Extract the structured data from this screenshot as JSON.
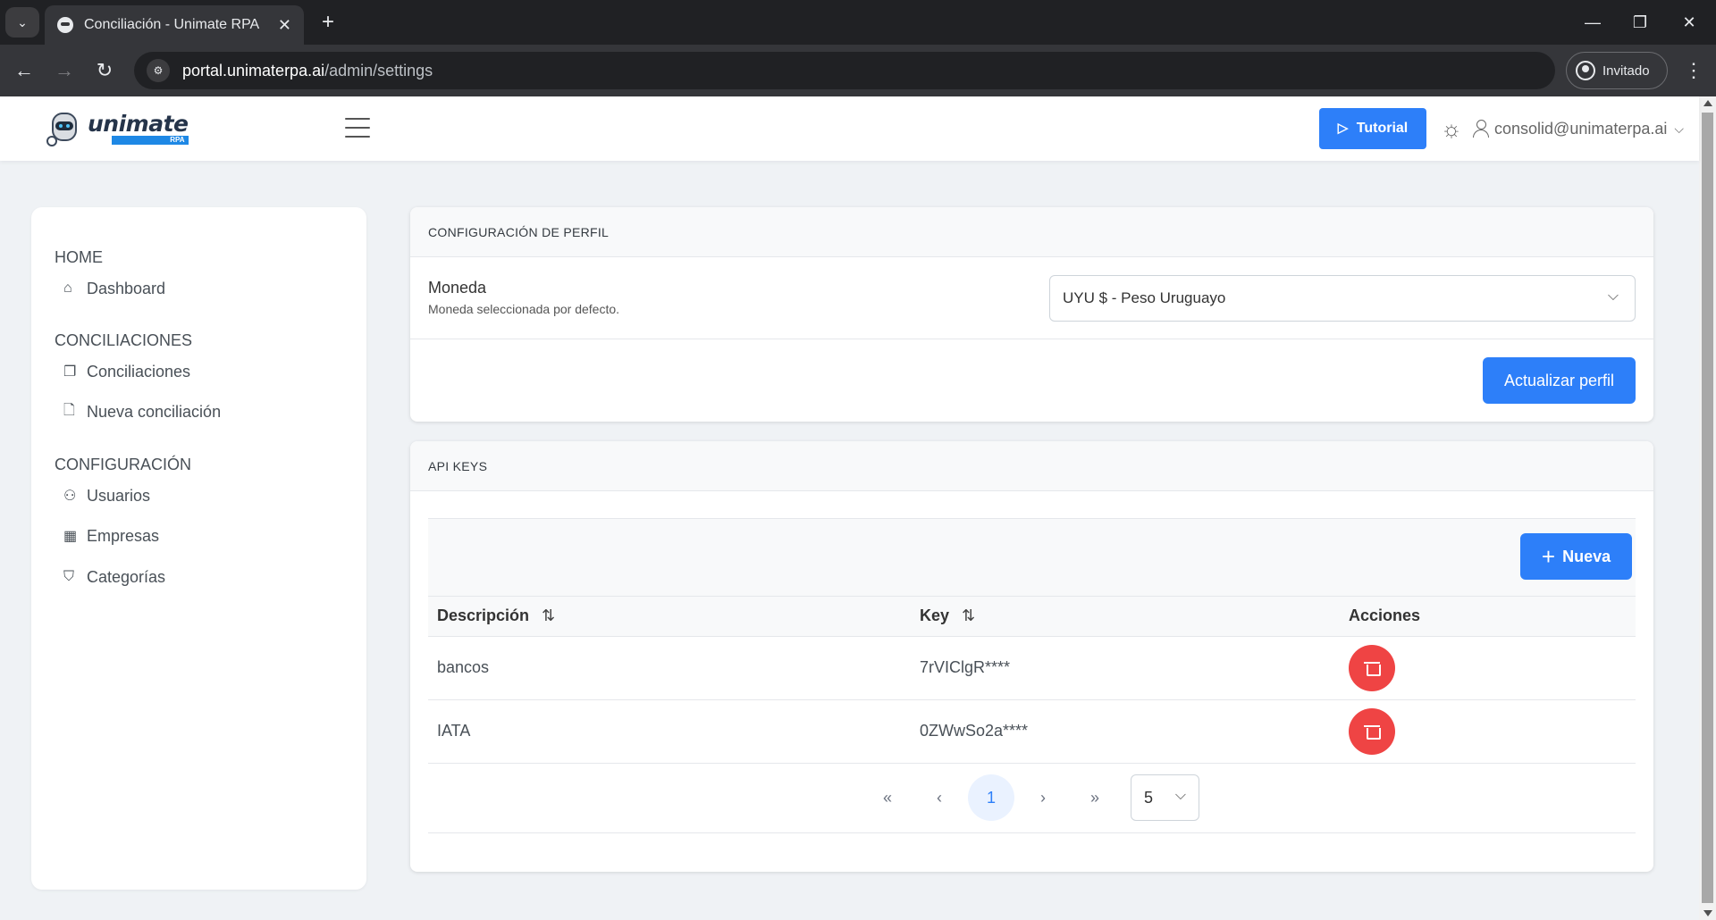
{
  "browser": {
    "tab_title": "Conciliación - Unimate RPA",
    "tab_close": "✕",
    "new_tab": "+",
    "url_host": "portal.unimaterpa.ai",
    "url_path": "/admin/settings",
    "profile_label": "Invitado",
    "win_minimize": "—",
    "win_restore": "❐",
    "win_close": "✕"
  },
  "header": {
    "logo_word": "unimate",
    "logo_sub": "RPA",
    "tutorial_label": "Tutorial",
    "user_email": "consolid@unimaterpa.ai"
  },
  "sidebar": {
    "sections": [
      {
        "title": "HOME",
        "items": [
          {
            "label": "Dashboard",
            "icon": "home-icon"
          }
        ]
      },
      {
        "title": "CONCILIACIONES",
        "items": [
          {
            "label": "Conciliaciones",
            "icon": "copy-icon"
          },
          {
            "label": "Nueva conciliación",
            "icon": "file-icon"
          }
        ]
      },
      {
        "title": "CONFIGURACIÓN",
        "items": [
          {
            "label": "Usuarios",
            "icon": "users-icon"
          },
          {
            "label": "Empresas",
            "icon": "building-icon"
          },
          {
            "label": "Categorías",
            "icon": "tag-icon"
          }
        ]
      }
    ]
  },
  "profile": {
    "title": "CONFIGURACIÓN DE PERFIL",
    "field_label": "Moneda",
    "field_help": "Moneda seleccionada por defecto.",
    "currency_value": "UYU $ - Peso Uruguayo",
    "update_label": "Actualizar perfil"
  },
  "api_keys": {
    "title": "API KEYS",
    "new_label": "Nueva",
    "columns": [
      "Descripción",
      "Key",
      "Acciones"
    ],
    "rows": [
      {
        "description": "bancos",
        "key": "7rVIClgR****"
      },
      {
        "description": "IATA",
        "key": "0ZWwSo2a****"
      }
    ],
    "pagination": {
      "first": "«",
      "prev": "‹",
      "current_page": "1",
      "next": "›",
      "last": "»",
      "rows_per_page": "5"
    }
  },
  "colors": {
    "primary": "#2d7ff9",
    "danger": "#ef4444",
    "page_bg": "#eff2f5"
  }
}
